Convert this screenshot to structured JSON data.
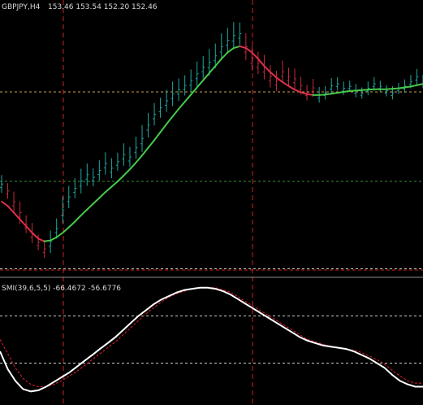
{
  "main_panel": {
    "symbol_label": "GBPJPY,H4",
    "ohlc_label": "153.46 153.54 152.20 152.46"
  },
  "indicator_panel": {
    "label": "SMI(39,6,5,5) -66.4672 -56.6776"
  },
  "colors": {
    "background": "#000000",
    "bar": "#1fa8a0",
    "bar_down": "#c42a3a",
    "ma_up": "#46c94a",
    "ma_down": "#e0304a",
    "smi_main": "#ffffff",
    "smi_signal": "#e02030",
    "vertical_marker": "#d02020",
    "level_line": "#c8c8c8",
    "price_level": "#c8a050",
    "price_level_green": "#3c8c3c",
    "panel_separator": "#909090"
  },
  "chart_data": [
    {
      "type": "line",
      "title": "GBPJPY,H4",
      "description_ohlc": "153.46 153.54 152.20 152.46",
      "series": [
        {
          "kind": "price_bars",
          "values": [
            150.9,
            150.75,
            150.5,
            150.25,
            150.0,
            149.8,
            149.6,
            149.45,
            149.6,
            149.9,
            150.3,
            150.6,
            150.8,
            150.95,
            151.1,
            151.05,
            151.2,
            151.35,
            151.25,
            151.4,
            151.55,
            151.5,
            151.7,
            151.9,
            152.2,
            152.45,
            152.6,
            152.75,
            152.9,
            153.0,
            153.1,
            153.2,
            153.35,
            153.5,
            153.6,
            153.75,
            153.95,
            154.1,
            154.2,
            154.25,
            153.95,
            153.7,
            153.6,
            153.5,
            153.3,
            153.2,
            153.4,
            153.3,
            153.25,
            153.1,
            152.95,
            153.05,
            152.9,
            152.95,
            153.1,
            153.15,
            153.05,
            153.1,
            153.0,
            152.95,
            153.05,
            153.15,
            153.1,
            153.0,
            152.95,
            153.05,
            153.1,
            153.2,
            153.3,
            153.2
          ],
          "ranges": [
            0.4,
            0.35,
            0.45,
            0.5,
            0.4,
            0.45,
            0.35,
            0.4,
            0.5,
            0.45,
            0.6,
            0.5,
            0.45,
            0.55,
            0.5,
            0.4,
            0.45,
            0.5,
            0.45,
            0.4,
            0.5,
            0.45,
            0.5,
            0.6,
            0.55,
            0.5,
            0.45,
            0.5,
            0.55,
            0.5,
            0.45,
            0.5,
            0.55,
            0.5,
            0.6,
            0.55,
            0.6,
            0.55,
            0.6,
            0.5,
            0.6,
            0.55,
            0.5,
            0.55,
            0.5,
            0.45,
            0.5,
            0.4,
            0.45,
            0.4,
            0.35,
            0.4,
            0.35,
            0.3,
            0.35,
            0.3,
            0.3,
            0.25,
            0.3,
            0.25,
            0.3,
            0.3,
            0.25,
            0.25,
            0.3,
            0.25,
            0.3,
            0.3,
            0.35,
            0.3
          ]
        },
        {
          "kind": "moving_average",
          "values": [
            150.55,
            150.45,
            150.3,
            150.15,
            150.0,
            149.85,
            149.72,
            149.66,
            149.68,
            149.75,
            149.85,
            149.97,
            150.1,
            150.24,
            150.37,
            150.5,
            150.63,
            150.76,
            150.88,
            151.0,
            151.13,
            151.27,
            151.42,
            151.58,
            151.75,
            151.92,
            152.1,
            152.28,
            152.45,
            152.62,
            152.78,
            152.94,
            153.1,
            153.26,
            153.42,
            153.58,
            153.74,
            153.88,
            153.98,
            154.02,
            153.98,
            153.88,
            153.74,
            153.58,
            153.44,
            153.32,
            153.22,
            153.13,
            153.05,
            152.99,
            152.95,
            152.93,
            152.93,
            152.94,
            152.96,
            152.98,
            153.0,
            153.02,
            153.03,
            153.04,
            153.05,
            153.06,
            153.06,
            153.06,
            153.07,
            153.08,
            153.1,
            153.12,
            153.15,
            153.18
          ]
        }
      ],
      "levels": [
        153.0,
        151.0
      ],
      "ylim": [
        149.0,
        154.8
      ]
    },
    {
      "type": "line",
      "title": "SMI(39,6,5,5)",
      "series": [
        {
          "name": "SMI",
          "value": -66.4672,
          "values": [
            -30,
            -45,
            -55,
            -62,
            -64,
            -63,
            -60,
            -56,
            -52,
            -48,
            -43,
            -38,
            -33,
            -28,
            -23,
            -18,
            -12,
            -6,
            0,
            5,
            10,
            14,
            17,
            20,
            22,
            23,
            24,
            24,
            23,
            21,
            18,
            14,
            10,
            6,
            2,
            -2,
            -6,
            -10,
            -14,
            -18,
            -21,
            -23,
            -25,
            -26,
            -27,
            -28,
            -30,
            -33,
            -36,
            -40,
            -44,
            -50,
            -55,
            -58,
            -60,
            -60
          ]
        },
        {
          "name": "Signal",
          "value": -56.6776,
          "values": [
            -20,
            -32,
            -44,
            -53,
            -58,
            -60,
            -60,
            -58,
            -55,
            -51,
            -47,
            -42,
            -37,
            -32,
            -27,
            -22,
            -16,
            -10,
            -4,
            2,
            7,
            12,
            16,
            19,
            21,
            23,
            24,
            24,
            24,
            22,
            20,
            16,
            12,
            8,
            4,
            0,
            -4,
            -8,
            -12,
            -16,
            -20,
            -22,
            -24,
            -26,
            -27,
            -28,
            -29,
            -31,
            -34,
            -37,
            -41,
            -46,
            -51,
            -55,
            -57,
            -57
          ]
        }
      ],
      "levels": [
        40,
        0,
        -40
      ],
      "ylim": [
        -70,
        30
      ]
    }
  ]
}
